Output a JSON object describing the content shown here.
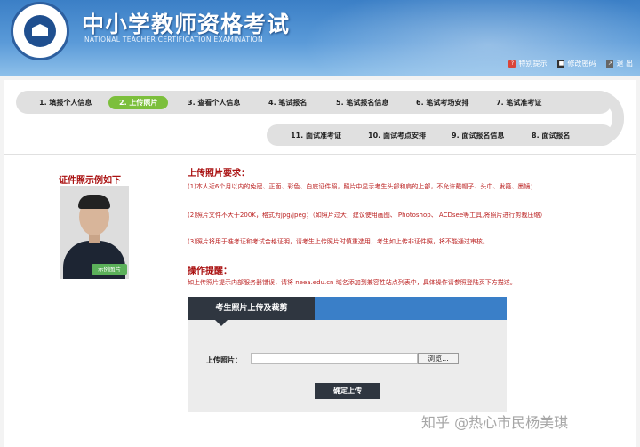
{
  "header": {
    "title": "中小学教师资格考试",
    "subtitle": "NATIONAL TEACHER CERTIFICATION EXAMINATION",
    "links": [
      {
        "icon": "?",
        "label": "特别提示"
      },
      {
        "icon": "■",
        "label": "修改密码"
      },
      {
        "icon": "↗",
        "label": "退 出"
      }
    ]
  },
  "steps_row1": [
    {
      "label": "1. 填报个人信息"
    },
    {
      "label": "2. 上传照片",
      "active": true
    },
    {
      "label": "3. 查看个人信息"
    },
    {
      "label": "4. 笔试报名"
    },
    {
      "label": "5. 笔试报名信息"
    },
    {
      "label": "6. 笔试考场安排"
    },
    {
      "label": "7. 笔试准考证"
    }
  ],
  "steps_row2": [
    {
      "label": "11. 面试准考证"
    },
    {
      "label": "10. 面试考点安排"
    },
    {
      "label": "9. 面试报名信息"
    },
    {
      "label": "8. 面试报名"
    }
  ],
  "sample": {
    "title": "证件照示例如下",
    "badge": "示例图片"
  },
  "requirements": {
    "title": "上传照片要求：",
    "items": [
      "(1)本人近6个月以内的免冠、正面、彩色、白底证件照，照片中显示考生头部和肩的上部，不允许戴帽子、头巾、发箍、墨镜；",
      "(2)照片文件不大于200K，格式为jpg/jpeg；（如照片过大，建议使用画图、 Photoshop、 ACDsee等工具,将照片进行剪裁压缩）",
      "(3)照片将用于准考证和考试合格证明，请考生上传照片时慎重选用，考生如上传非证件照，将不能通过审核。"
    ]
  },
  "tips": {
    "title": "操作提醒：",
    "text": "如上传照片提示内部服务器错误，请将 neea.edu.cn 域名添加到兼容性站点列表中，具体操作请参照登陆页下方描述。"
  },
  "upload": {
    "panel_title": "考生照片上传及裁剪",
    "field_label": "上传照片：",
    "browse_label": "浏览...",
    "confirm_label": "确定上传"
  },
  "watermark": "知乎 @热心市民杨美琪"
}
